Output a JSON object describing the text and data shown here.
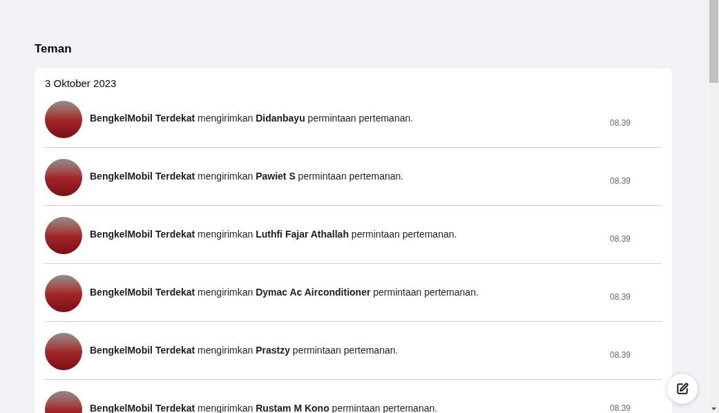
{
  "page": {
    "title": "Teman"
  },
  "group": {
    "date": "3 Oktober 2023",
    "notifications": [
      {
        "text": "**BengkelMobil Terdekat** mengirimkan **Didanbayu** permintaan pertemanan.",
        "time": "08.39"
      },
      {
        "text": "**BengkelMobil Terdekat** mengirimkan **Pawiet S** permintaan pertemanan.",
        "time": "08.39"
      },
      {
        "text": "**BengkelMobil Terdekat** mengirimkan **Luthfi Fajar Athallah** permintaan pertemanan.",
        "time": "08.39"
      },
      {
        "text": "**BengkelMobil Terdekat** mengirimkan **Dymac Ac Airconditioner** permintaan pertemanan.",
        "time": "08.39"
      },
      {
        "text": "**BengkelMobil Terdekat** mengirimkan **Prastzy** permintaan pertemanan.",
        "time": "08.39"
      },
      {
        "text": "**BengkelMobil Terdekat** mengirimkan **Rustam M Kono** permintaan pertemanan.",
        "time": "08.39"
      }
    ]
  }
}
